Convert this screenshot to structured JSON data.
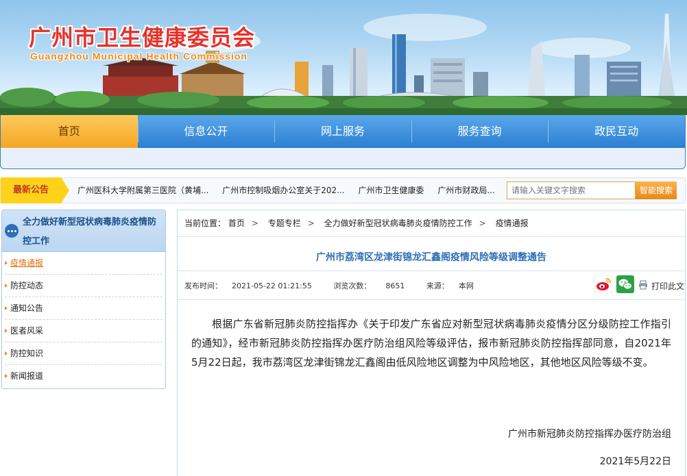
{
  "header": {
    "title": "广州市卫生健康委员会",
    "subtitle": "Guangzhou Municipal Health Commission"
  },
  "nav": {
    "items": [
      {
        "label": "首页",
        "active": true
      },
      {
        "label": "信息公开",
        "active": false
      },
      {
        "label": "网上服务",
        "active": false
      },
      {
        "label": "服务查询",
        "active": false
      },
      {
        "label": "政民互动",
        "active": false
      }
    ]
  },
  "notice": {
    "label": "最新公告",
    "items": [
      "广州医科大学附属第三医院（黄埔...",
      "广州市控制吸烟办公室关于202...",
      "广州市卫生健康委",
      "广州市财政局..."
    ]
  },
  "search": {
    "placeholder": "请输入关键文字搜索",
    "button_label": "智能搜索"
  },
  "sidebar": {
    "title": "全力做好新型冠状病毒肺炎疫情防控工作",
    "items": [
      {
        "label": "疫情通报",
        "active": true
      },
      {
        "label": "防控动态",
        "active": false
      },
      {
        "label": "通知公告",
        "active": false
      },
      {
        "label": "医者风采",
        "active": false
      },
      {
        "label": "防控知识",
        "active": false
      },
      {
        "label": "新闻报道",
        "active": false
      }
    ]
  },
  "breadcrumb": {
    "prefix": "当前位置：",
    "items": [
      "首页",
      "专题专栏",
      "全力做好新型冠状病毒肺炎疫情防控工作",
      "疫情通报"
    ]
  },
  "article": {
    "title": "广州市荔湾区龙津街锦龙汇鑫阁疫情风险等级调整通告",
    "publish_label": "发布时间：",
    "publish_time": "2021-05-22 01:21:55",
    "views_label": "浏览次数：",
    "views": "8651",
    "source_label": "来源：",
    "source": "本网",
    "print_label": "打印此文",
    "body": "根据广东省新冠肺炎防控指挥办《关于印发广东省应对新型冠状病毒肺炎疫情分区分级防控工作指引的通知》，经市新冠肺炎防控指挥办医疗防治组风险等级评估，报市新冠肺炎防控指挥部同意，自2021年5月22日起，我市荔湾区龙津街锦龙汇鑫阁由低风险地区调整为中风险地区，其他地区风险等级不变。",
    "signature": "广州市新冠肺炎防控指挥办医疗防治组",
    "date": "2021年5月22日"
  },
  "icons": {
    "share_weibo": "weibo-icon",
    "share_wechat": "wechat-icon",
    "print": "printer-icon",
    "sidebar_head": "chat-bubble-icon"
  },
  "colors": {
    "nav_blue": "#2b7fd3",
    "nav_active": "#f5a623",
    "title_red": "#e8312a",
    "article_title_blue": "#2d6fb8",
    "sidebar_active": "#e0720e"
  }
}
